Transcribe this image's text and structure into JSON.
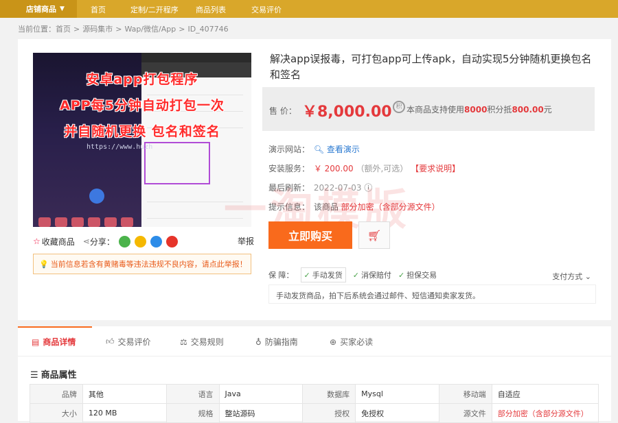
{
  "topnav": {
    "category_label": "店铺商品",
    "items": [
      "首页",
      "定制/二开程序",
      "商品列表",
      "交易评价"
    ]
  },
  "breadcrumb": {
    "prefix": "当前位置：",
    "parts": [
      "首页",
      "源码集市",
      "Wap/微信/App",
      "ID_407746"
    ]
  },
  "screenshot": {
    "overlay_lines": [
      "安卓app打包程序",
      "APP每5分钟自动打包一次",
      "并自随机更换 包名和签名"
    ],
    "url_text": "https://www.huzh"
  },
  "tools": {
    "favorite": "收藏商品",
    "share": "分享：",
    "report": "举报"
  },
  "warning": "当前信息若含有黄赌毒等违法违规不良内容，请点此举报！",
  "product": {
    "title": "解决app误报毒，可打包app可上传apk，自动实现5分钟随机更换包名和签名",
    "price_label": "售 价：",
    "price": "￥8,000.00",
    "jf_icon_text": "积",
    "points_prefix": "本商品支持使用",
    "points_amount": "8000",
    "points_mid": "积分抵",
    "points_value": "800.00",
    "points_suffix": "元",
    "demo_label": "演示网站：",
    "demo_link": "查看演示",
    "install_label": "安装服务：",
    "install_price": "￥ 200.00",
    "install_note": "（额外,可选）",
    "install_req": "【要求说明】",
    "refresh_label": "最后刷新：",
    "refresh_date": "2022-07-03",
    "tip_label": "提示信息：",
    "tip_text": "该商品",
    "tip_red": "部分加密（含部分源文件）",
    "buy_button": "立即购买",
    "watermark": "一淘模版"
  },
  "guarantee": {
    "label": "保 障：",
    "items": [
      "手动发货",
      "消保赔付",
      "担保交易"
    ],
    "pay": "支付方式",
    "note": "手动发货商品，拍下后系统会通过邮件、短信通知卖家发货。"
  },
  "tabs": [
    "商品详情",
    "交易评价",
    "交易规则",
    "防骗指南",
    "买家必读"
  ],
  "attributes": {
    "title": "商品属性",
    "rows": [
      [
        "品牌",
        "其他",
        "语言",
        "Java",
        "数据库",
        "Mysql",
        "移动端",
        "自适应"
      ],
      [
        "大小",
        "120 MB",
        "规格",
        "整站源码",
        "授权",
        "免授权",
        "源文件",
        "部分加密（含部分源文件）"
      ]
    ]
  },
  "colors": {
    "nav": "#d9a72a",
    "accent": "#f96a1c",
    "price": "#e4393c"
  }
}
